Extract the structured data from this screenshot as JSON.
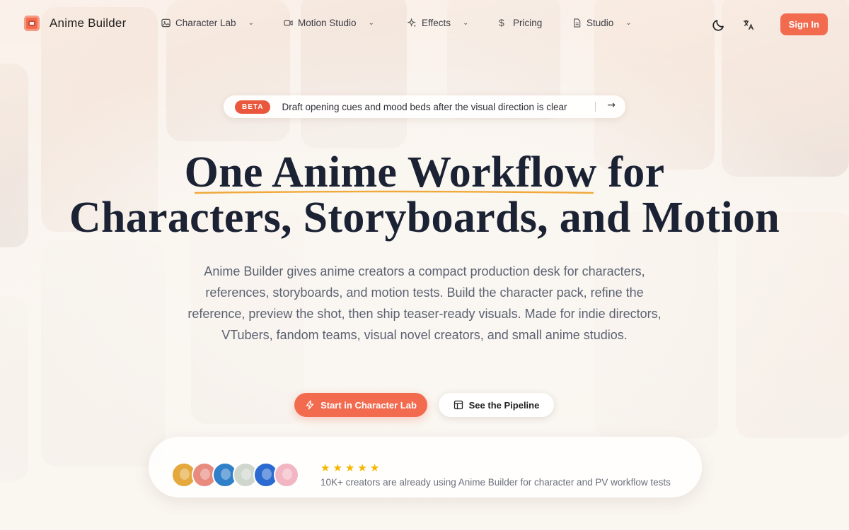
{
  "brand": {
    "name": "Anime Builder"
  },
  "nav": {
    "items": [
      {
        "label": "Character Lab",
        "icon": "image-icon",
        "has_dropdown": true
      },
      {
        "label": "Motion Studio",
        "icon": "video-icon",
        "has_dropdown": true
      },
      {
        "label": "Effects",
        "icon": "sparkles-icon",
        "has_dropdown": true
      },
      {
        "label": "Pricing",
        "icon": "dollar-icon",
        "has_dropdown": false
      },
      {
        "label": "Studio",
        "icon": "document-icon",
        "has_dropdown": true
      }
    ],
    "theme_toggle_icon": "moon-icon",
    "language_icon": "translate-icon",
    "sign_in_label": "Sign In"
  },
  "announcement": {
    "badge": "BETA",
    "text": "Draft opening cues and mood beds after the visual direction is clear",
    "arrow_icon": "arrow-right-icon"
  },
  "hero": {
    "title_line1": "One Anime Workflow for",
    "title_line2": "Characters, Storyboards, and Motion",
    "subtitle": "Anime Builder gives anime creators a compact production desk for characters, references, storyboards, and motion tests. Build the character pack, refine the reference, preview the shot, then ship teaser-ready visuals. Made for indie directors, VTubers, fandom teams, visual novel creators, and small anime studios."
  },
  "cta": {
    "primary_label": "Start in Character Lab",
    "primary_icon": "lightning-icon",
    "secondary_label": "See the Pipeline",
    "secondary_icon": "layout-icon"
  },
  "social_proof": {
    "avatar_count": 6,
    "rating_stars": 5,
    "text": "10K+ creators are already using Anime Builder for character and PV workflow tests"
  },
  "colors": {
    "accent": "#f26b4f",
    "title": "#1b2233",
    "underline": "#f0a93a",
    "star": "#f5b800"
  }
}
